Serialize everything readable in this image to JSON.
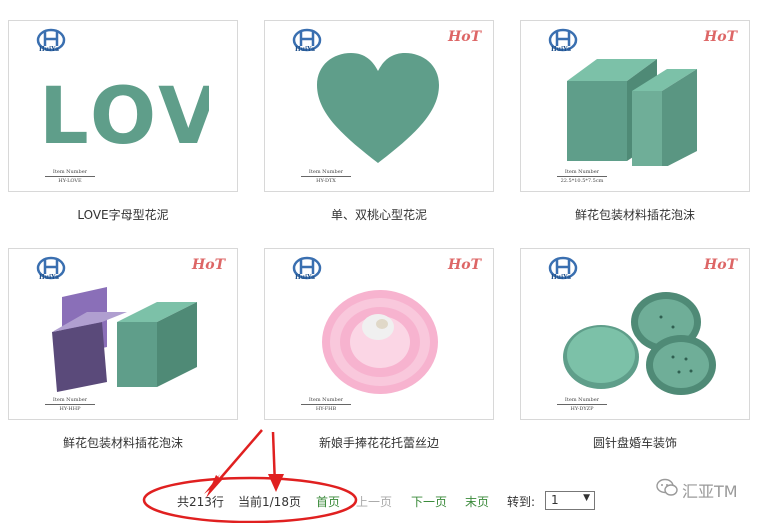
{
  "products": [
    {
      "title": "LOVE字母型花泥",
      "item_label": "Item Number",
      "item_code": "HY-LOVE",
      "hot": false
    },
    {
      "title": "单、双桃心型花泥",
      "item_label": "Item Number",
      "item_code": "HY-DTX",
      "hot": true
    },
    {
      "title": "鲜花包装材料插花泡沫",
      "item_label": "Item Number",
      "item_code": "22.5*10.5*7.5cm",
      "hot": true
    },
    {
      "title": "鲜花包装材料插花泡沫",
      "item_label": "Item Number",
      "item_code": "HY-HHP",
      "hot": true
    },
    {
      "title": "新娘手捧花花托蕾丝边",
      "item_label": "Item Number",
      "item_code": "HY-FHB",
      "hot": true
    },
    {
      "title": "圆针盘婚车装饰",
      "item_label": "Item Number",
      "item_code": "HY-DYZP",
      "hot": true
    }
  ],
  "brand": {
    "logo_text": "HuiYa",
    "hot_text": "HoT"
  },
  "love_letters": "LOVE",
  "pagination": {
    "total": "共213行",
    "current": "当前1/18页",
    "first": "首页",
    "prev": "上一页",
    "next": "下一页",
    "last": "末页",
    "goto_label": "转到:",
    "goto_value": "1"
  },
  "watermark": "汇亚TM",
  "colors": {
    "foam_green": "#5f9e8a",
    "link_green": "#3a8a3a",
    "annotation_red": "#e02020"
  }
}
